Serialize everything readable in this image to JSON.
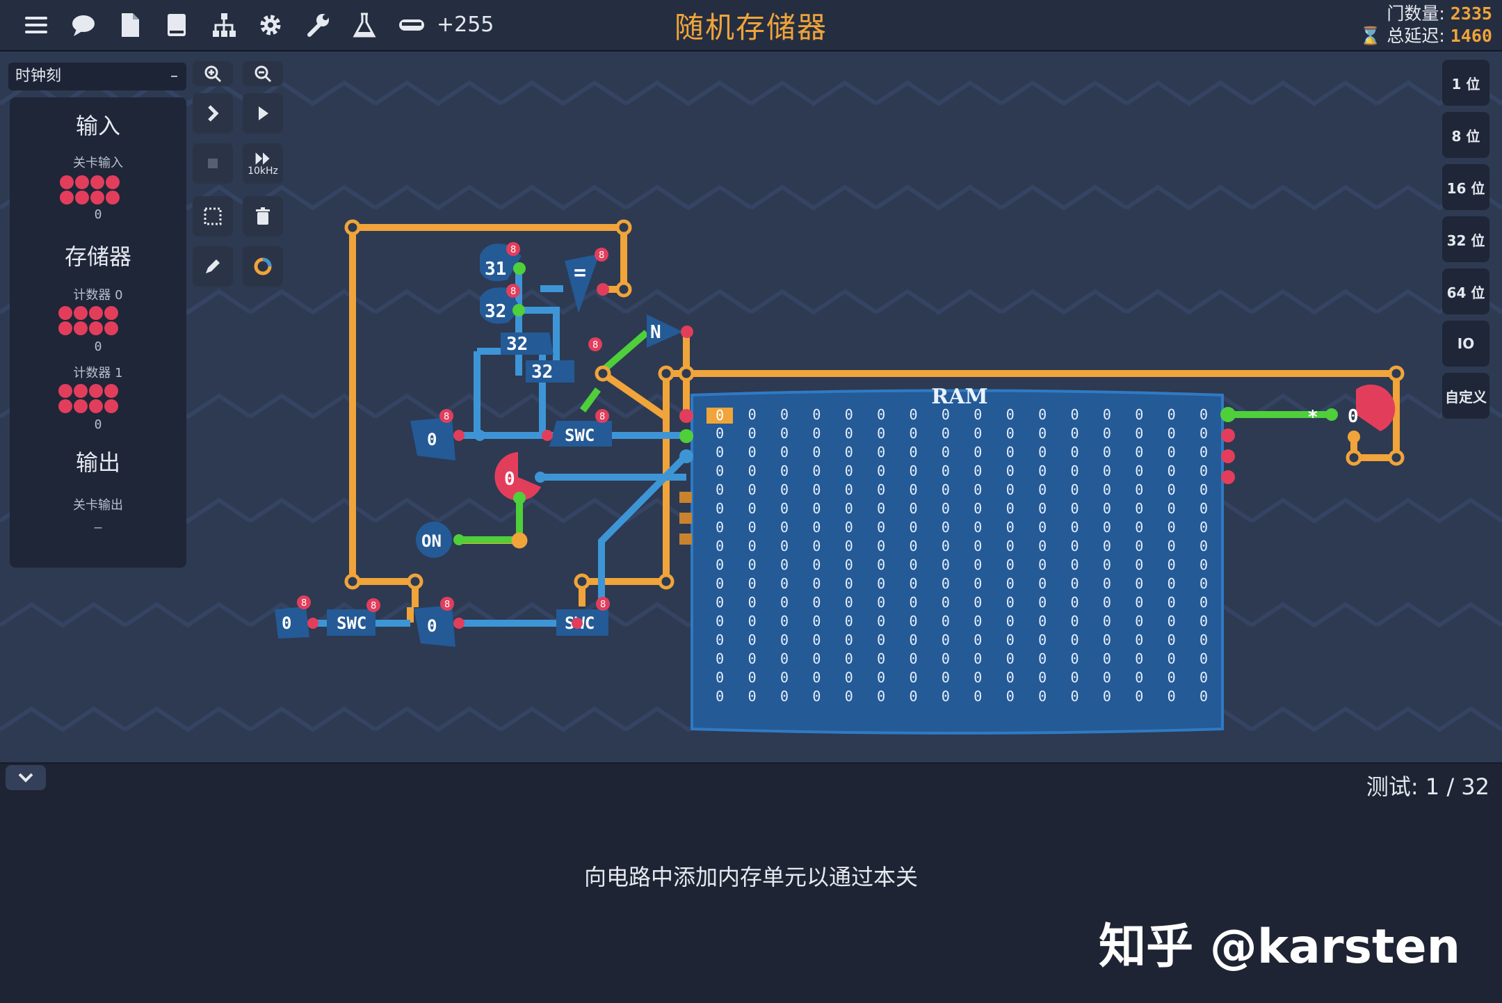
{
  "toolbar": {
    "icons": [
      "menu-icon",
      "chat-icon",
      "file-icon",
      "book-icon",
      "hierarchy-icon",
      "gear-icon",
      "wrench-icon",
      "flask-icon",
      "tape-icon"
    ],
    "gate_bonus": "+255"
  },
  "level_title": "随机存储器",
  "stats": {
    "gate_count_label": "门数量:",
    "gate_count_value": "2335",
    "delay_label": "总延迟:",
    "delay_value": "1460"
  },
  "left_panel": {
    "clock_select": "时钟刻",
    "clock_minus": "–",
    "input_header": "输入",
    "level_input_label": "关卡输入",
    "level_input_value": "0",
    "memory_header": "存储器",
    "counter0_label": "计数器 0",
    "counter0_value": "0",
    "counter1_label": "计数器 1",
    "counter1_value": "0",
    "output_header": "输出",
    "level_output_label": "关卡输出",
    "level_output_value": "–"
  },
  "tools": {
    "speed_label": "10kHz"
  },
  "right_panel": {
    "buttons": [
      "1 位",
      "8 位",
      "16 位",
      "32 位",
      "64 位",
      "IO",
      "自定义"
    ]
  },
  "circuit": {
    "ram_title": "RAM",
    "ram_rows": 16,
    "ram_cols": 16,
    "ram_cell_value": "0",
    "labels": {
      "const31": "31",
      "const32a": "32",
      "const32b": "32",
      "const32c": "32",
      "eq": "=",
      "not": "N",
      "swc1": "SWC",
      "swc2": "SWC",
      "swc3": "SWC",
      "reg_value": "0",
      "counter_value": "0",
      "on": "ON",
      "in_value": "0",
      "mid_value": "0",
      "mid_value2": "0",
      "out_value": "0",
      "out_marker": "*",
      "bit_badge": "8"
    }
  },
  "bottom": {
    "test_label": "测试:",
    "test_progress": "1 / 32",
    "hint": "向电路中添加内存单元以通过本关",
    "watermark": "知乎 @karsten"
  },
  "colors": {
    "wire_orange": "#f0a43a",
    "wire_blue": "#3e95d6",
    "wire_green": "#4fcf3a",
    "pin_red": "#e23e5c",
    "ram_blue": "#245a96",
    "accent_orange": "#f0a43a"
  }
}
